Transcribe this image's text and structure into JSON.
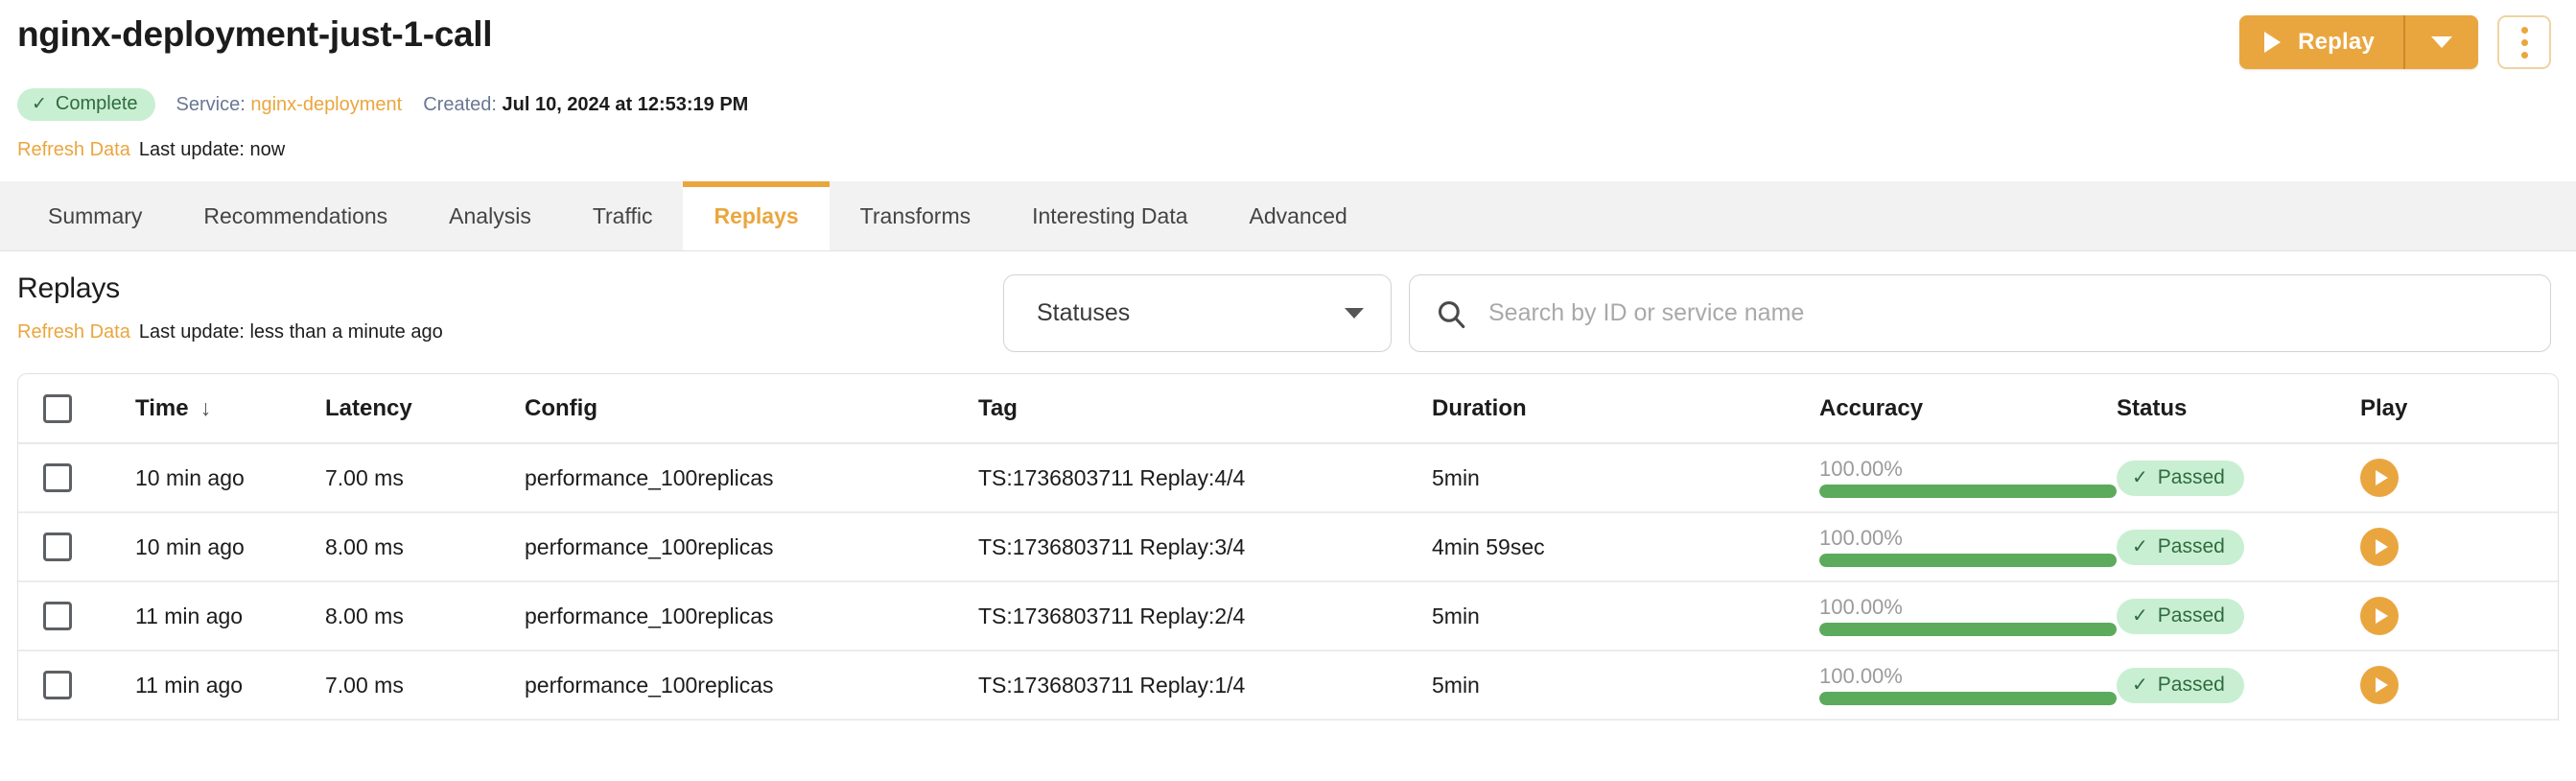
{
  "header": {
    "title": "nginx-deployment-just-1-call",
    "status_badge": {
      "label": "Complete",
      "icon": "check-icon",
      "bg": "#c9efd2",
      "fg": "#2f6b40"
    },
    "service_label": "Service:",
    "service_name": "nginx-deployment",
    "created_label": "Created:",
    "created_value": "Jul 10, 2024 at 12:53:19 PM",
    "refresh_link": "Refresh Data",
    "refresh_note": "Last update: now",
    "replay_button": {
      "label": "Replay",
      "icon": "play-icon",
      "caret_icon": "chevron-down-icon"
    },
    "kebab_icon": "more-vertical-icon"
  },
  "tabs": [
    {
      "label": "Summary",
      "active": false
    },
    {
      "label": "Recommendations",
      "active": false
    },
    {
      "label": "Analysis",
      "active": false
    },
    {
      "label": "Traffic",
      "active": false
    },
    {
      "label": "Replays",
      "active": true
    },
    {
      "label": "Transforms",
      "active": false
    },
    {
      "label": "Interesting Data",
      "active": false
    },
    {
      "label": "Advanced",
      "active": false
    }
  ],
  "section": {
    "title": "Replays",
    "refresh_link": "Refresh Data",
    "refresh_note": "Last update: less than a minute ago",
    "status_filter": {
      "label": "Statuses",
      "caret_icon": "chevron-down-icon"
    },
    "search": {
      "placeholder": "Search by ID or service name",
      "value": "",
      "icon": "search-icon"
    }
  },
  "table": {
    "select_all_icon": "checkbox-icon",
    "columns": [
      {
        "key": "time",
        "label": "Time",
        "sort": "↓"
      },
      {
        "key": "latency",
        "label": "Latency"
      },
      {
        "key": "config",
        "label": "Config"
      },
      {
        "key": "tag",
        "label": "Tag"
      },
      {
        "key": "duration",
        "label": "Duration"
      },
      {
        "key": "accuracy",
        "label": "Accuracy"
      },
      {
        "key": "status",
        "label": "Status"
      },
      {
        "key": "play",
        "label": "Play"
      }
    ],
    "rows": [
      {
        "time": "10 min ago",
        "latency": "7.00 ms",
        "config": "performance_100replicas",
        "tag": "TS:1736803711 Replay:4/4",
        "duration": "5min",
        "accuracy_text": "100.00%",
        "accuracy_pct": 100,
        "status": "Passed",
        "play_icon": "play-icon"
      },
      {
        "time": "10 min ago",
        "latency": "8.00 ms",
        "config": "performance_100replicas",
        "tag": "TS:1736803711 Replay:3/4",
        "duration": "4min 59sec",
        "accuracy_text": "100.00%",
        "accuracy_pct": 100,
        "status": "Passed",
        "play_icon": "play-icon"
      },
      {
        "time": "11 min ago",
        "latency": "8.00 ms",
        "config": "performance_100replicas",
        "tag": "TS:1736803711 Replay:2/4",
        "duration": "5min",
        "accuracy_text": "100.00%",
        "accuracy_pct": 100,
        "status": "Passed",
        "play_icon": "play-icon"
      },
      {
        "time": "11 min ago",
        "latency": "7.00 ms",
        "config": "performance_100replicas",
        "tag": "TS:1736803711 Replay:1/4",
        "duration": "5min",
        "accuracy_text": "100.00%",
        "accuracy_pct": 100,
        "status": "Passed",
        "play_icon": "play-icon"
      }
    ]
  },
  "colors": {
    "accent": "#eaa63e",
    "success_bg": "#c9efd2",
    "success_fg": "#2f6b40",
    "progress_fill": "#5caa5c",
    "muted": "#6b7793"
  }
}
